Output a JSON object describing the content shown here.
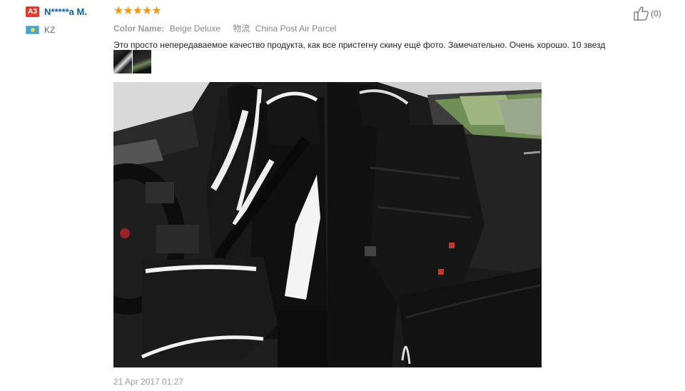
{
  "user": {
    "level": "A3",
    "name": "N*****a M.",
    "country": "KZ"
  },
  "rating": {
    "stars": 5,
    "max": 5
  },
  "meta": {
    "color_label": "Color Name:",
    "color_value": "Beige Deluxe",
    "shipping_label": "物流",
    "shipping_value": "China Post Air Parcel"
  },
  "feedback": "Это просто непередаваемое качество продукта, как все пристегну скину ещё фото. Замечательно. Очень хорошо. 10 звезд",
  "date": "21 Apr 2017 01:27",
  "helpful": {
    "count": "(0)"
  },
  "icons": {
    "thumbs_up": "thumbs-up-icon",
    "flag": "kz-flag-icon",
    "star": "star-icon"
  },
  "colors": {
    "star": "#ff9600",
    "badge": "#e53a2f",
    "username": "#0a5ea8"
  }
}
